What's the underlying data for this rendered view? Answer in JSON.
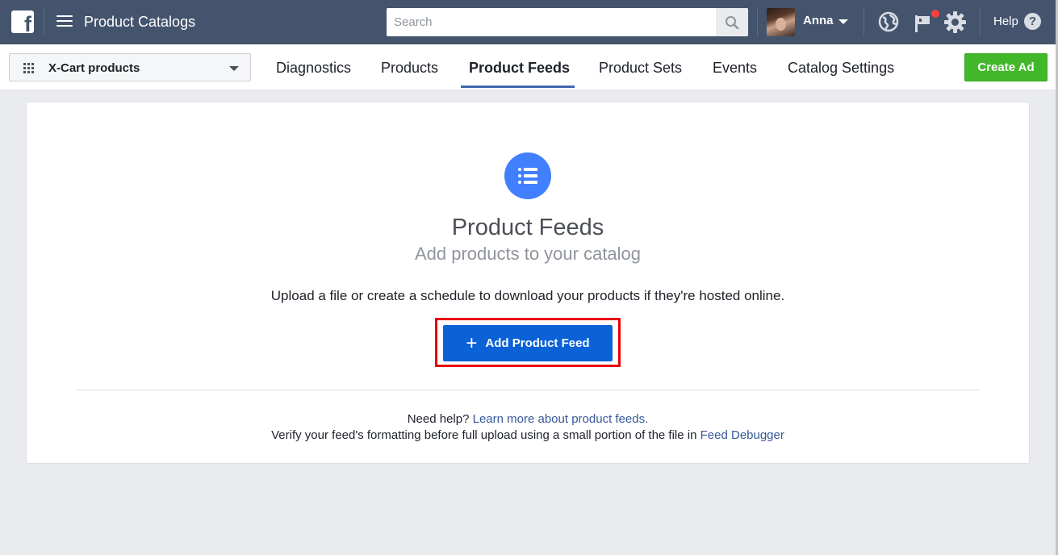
{
  "topbar": {
    "app_title": "Product Catalogs",
    "search_placeholder": "Search",
    "user_name": "Anna",
    "help_label": "Help",
    "help_icon_glyph": "?"
  },
  "subbar": {
    "catalog_name": "X-Cart products",
    "tabs": [
      {
        "label": "Diagnostics",
        "active": false
      },
      {
        "label": "Products",
        "active": false
      },
      {
        "label": "Product Feeds",
        "active": true
      },
      {
        "label": "Product Sets",
        "active": false
      },
      {
        "label": "Events",
        "active": false
      },
      {
        "label": "Catalog Settings",
        "active": false
      }
    ],
    "create_ad_label": "Create Ad"
  },
  "main": {
    "title": "Product Feeds",
    "subtitle": "Add products to your catalog",
    "description": "Upload a file or create a schedule to download your products if they're hosted online.",
    "add_button_label": "Add Product Feed",
    "help_prefix": "Need help?",
    "help_link": "Learn more about product feeds.",
    "verify_text": "Verify your feed's formatting before full upload using a small portion of the file in",
    "verify_link": "Feed Debugger"
  },
  "colors": {
    "topbar": "#44546d",
    "accent_blue": "#0a62d6",
    "tab_underline": "#4267b2",
    "create_ad_green": "#42b72a",
    "highlight_red": "#e60000",
    "feed_icon_blue": "#4080ff"
  },
  "icons": [
    "facebook-logo",
    "hamburger-icon",
    "search-icon",
    "avatar",
    "caret-down-icon",
    "globe-icon",
    "flag-icon",
    "gear-icon",
    "help-icon",
    "grid-icon",
    "list-icon",
    "plus-icon"
  ]
}
